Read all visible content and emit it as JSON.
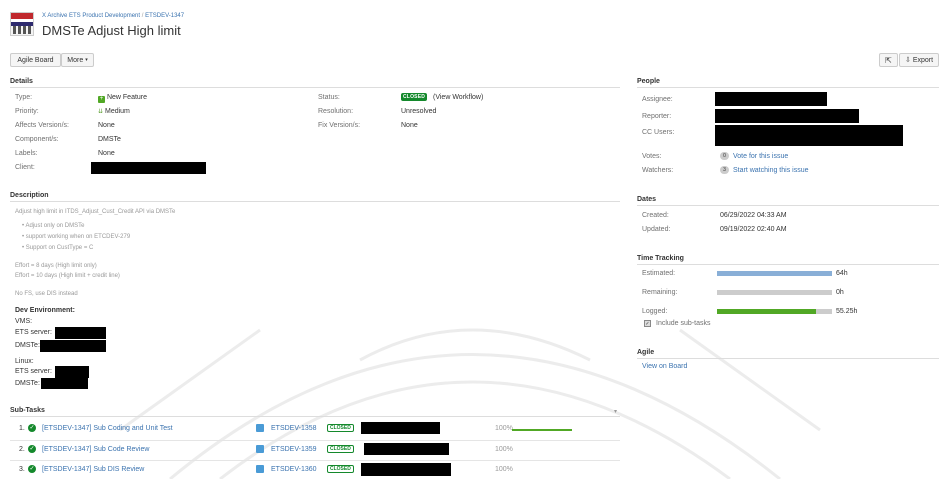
{
  "header": {
    "breadcrumb_project": "X Archive ETS Product Development",
    "breadcrumb_sep": "/",
    "breadcrumb_issue": "ETSDEV-1347",
    "title": "DMSTe Adjust High limit"
  },
  "toolbar": {
    "agile_board": "Agile Board",
    "more": "More",
    "export": "Export"
  },
  "details": {
    "section_title": "Details",
    "type_label": "Type:",
    "type_value": "New Feature",
    "priority_label": "Priority:",
    "priority_value": "Medium",
    "affects_label": "Affects Version/s:",
    "affects_value": "None",
    "component_label": "Component/s:",
    "component_value": "DMSTe",
    "labels_label": "Labels:",
    "labels_value": "None",
    "client_label": "Client:",
    "status_label": "Status:",
    "status_value": "CLOSED",
    "view_workflow": "(View Workflow)",
    "resolution_label": "Resolution:",
    "resolution_value": "Unresolved",
    "fix_label": "Fix Version/s:",
    "fix_value": "None"
  },
  "description": {
    "section_title": "Description",
    "line1": "Adjust high limit in ITDS_Adjust_Cust_Credit API via DMSTe",
    "bullets": [
      "Adjust only on DMSTe",
      "support working when on ETCDEV-279",
      "Support on CustType = C"
    ],
    "effort1": "Effort = 8 days (High limit only)",
    "effort2": "Effort = 10 days (High limit + credit line)",
    "note": "No FS, use DIS instead",
    "dev_env": "Dev Environment:",
    "vms": "VMS:",
    "ets_server": "ETS server:",
    "dmste": "DMSTe:",
    "linux": "Linux:",
    "ets_server2": "ETS server:",
    "dmste2": "DMSTe:"
  },
  "subtasks": {
    "section_title": "Sub-Tasks",
    "items": [
      {
        "num": "1.",
        "title": "[ETSDEV-1347] Sub Coding and Unit Test",
        "key": "ETSDEV-1358",
        "status": "CLOSED",
        "pct": "100%"
      },
      {
        "num": "2.",
        "title": "[ETSDEV-1347] Sub Code Review",
        "key": "ETSDEV-1359",
        "status": "CLOSED",
        "pct": "100%"
      },
      {
        "num": "3.",
        "title": "[ETSDEV-1347] Sub DIS Review",
        "key": "ETSDEV-1360",
        "status": "CLOSED",
        "pct": "100%"
      }
    ]
  },
  "people": {
    "section_title": "People",
    "assignee_label": "Assignee:",
    "reporter_label": "Reporter:",
    "cc_label": "CC Users:",
    "votes_label": "Votes:",
    "votes_count": "0",
    "vote_link": "Vote for this issue",
    "watchers_label": "Watchers:",
    "watchers_count": "3",
    "watch_link": "Start watching this issue"
  },
  "dates": {
    "section_title": "Dates",
    "created_label": "Created:",
    "created_value": "06/29/2022 04:33 AM",
    "updated_label": "Updated:",
    "updated_value": "09/19/2022 02:40 AM"
  },
  "time_tracking": {
    "section_title": "Time Tracking",
    "estimated_label": "Estimated:",
    "estimated_value": "64h",
    "estimated_fraction": 1.0,
    "remaining_label": "Remaining:",
    "remaining_value": "0h",
    "remaining_fraction": 0.0,
    "logged_label": "Logged:",
    "logged_value": "55.25h",
    "logged_fraction": 0.86,
    "include_subtasks": "Include sub-tasks",
    "colors": {
      "estimated": "#89afd7",
      "logged": "#51a825",
      "track": "#cccccc"
    }
  },
  "agile": {
    "section_title": "Agile",
    "view_on_board": "View on Board"
  }
}
